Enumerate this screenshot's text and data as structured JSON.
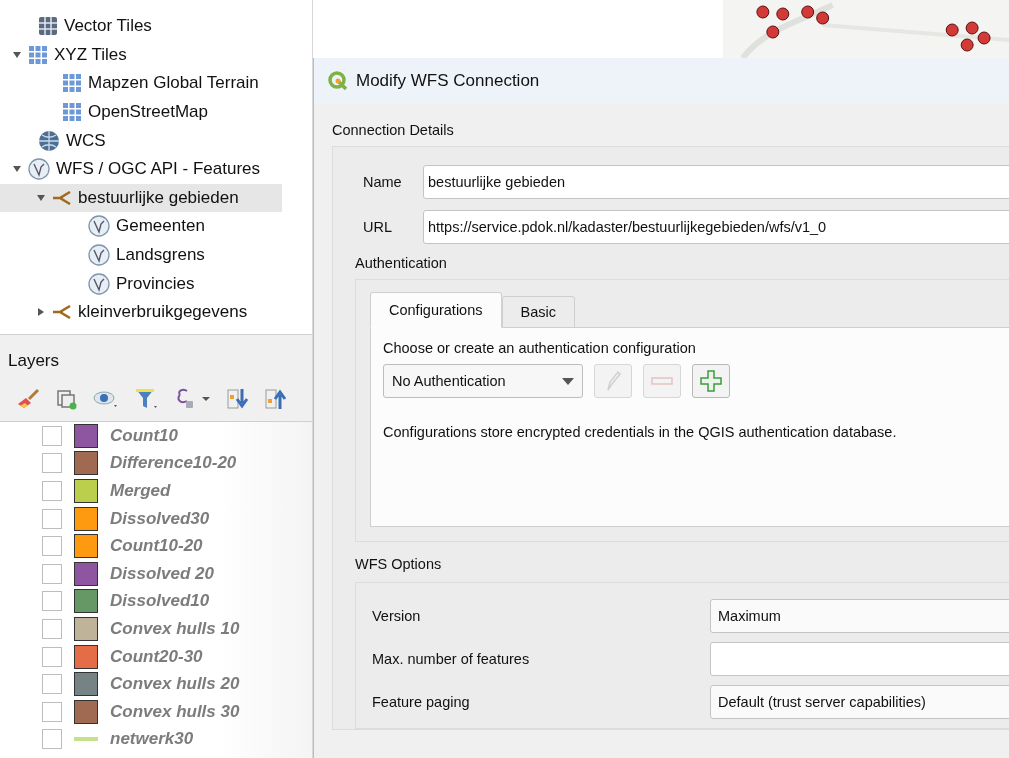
{
  "browser_tree": [
    {
      "label": "Vector Tiles",
      "kind": "vector_tiles",
      "selected": false
    },
    {
      "label": "XYZ Tiles",
      "kind": "xyz",
      "selected": false,
      "expanded": true,
      "children": [
        {
          "label": "Mapzen Global Terrain",
          "kind": "xyz",
          "selected": false
        },
        {
          "label": "OpenStreetMap",
          "kind": "xyz",
          "selected": false
        }
      ]
    },
    {
      "label": "WCS",
      "kind": "wcs",
      "selected": false
    },
    {
      "label": "WFS / OGC API - Features",
      "kind": "wfs",
      "selected": false,
      "expanded": true,
      "children": [
        {
          "label": "bestuurlijke gebieden",
          "kind": "connection",
          "selected": true,
          "expanded": true,
          "children": [
            {
              "label": "Gemeenten",
              "kind": "wfs",
              "selected": false
            },
            {
              "label": "Landsgrens",
              "kind": "wfs",
              "selected": false
            },
            {
              "label": "Provincies",
              "kind": "wfs",
              "selected": false
            }
          ]
        },
        {
          "label": "kleinverbruikgegevens",
          "kind": "connection",
          "selected": false,
          "expanded": false
        }
      ]
    }
  ],
  "layers_panel": {
    "title": "Layers",
    "layers": [
      {
        "name": "Count10",
        "kind": "fill",
        "color": "#8e56a0",
        "checked": false
      },
      {
        "name": "Difference10-20",
        "kind": "fill",
        "color": "#a06a52",
        "checked": false
      },
      {
        "name": "Merged",
        "kind": "fill",
        "color": "#bccf4c",
        "checked": false
      },
      {
        "name": "Dissolved30",
        "kind": "fill",
        "color": "#fd9a10",
        "checked": false
      },
      {
        "name": "Count10-20",
        "kind": "fill",
        "color": "#fd9a10",
        "checked": false
      },
      {
        "name": "Dissolved 20",
        "kind": "fill",
        "color": "#8e56a0",
        "checked": false
      },
      {
        "name": "Dissolved10",
        "kind": "fill",
        "color": "#669866",
        "checked": false
      },
      {
        "name": "Convex hulls 10",
        "kind": "fill",
        "color": "#bfb49a",
        "checked": false
      },
      {
        "name": "Count20-30",
        "kind": "fill",
        "color": "#e46d48",
        "checked": false
      },
      {
        "name": "Convex hulls 20",
        "kind": "fill",
        "color": "#758385",
        "checked": false
      },
      {
        "name": "Convex hulls 30",
        "kind": "fill",
        "color": "#a06a52",
        "checked": false
      },
      {
        "name": "netwerk30",
        "kind": "line",
        "color": "#c7e08a",
        "checked": false
      }
    ]
  },
  "dialog": {
    "title": "Modify WFS Connection",
    "connection_details": {
      "title": "Connection Details",
      "name_label": "Name",
      "name_value": "bestuurlijke gebieden",
      "url_label": "URL",
      "url_value": "https://service.pdok.nl/kadaster/bestuurlijkegebieden/wfs/v1_0"
    },
    "authentication": {
      "title": "Authentication",
      "tabs": [
        {
          "label": "Configurations",
          "selected": true
        },
        {
          "label": "Basic",
          "selected": false
        }
      ],
      "prompt": "Choose or create an authentication configuration",
      "config_select": "No Authentication",
      "buttons": [
        {
          "kind": "edit",
          "disabled": true
        },
        {
          "kind": "remove",
          "disabled": true
        },
        {
          "kind": "add",
          "disabled": false
        }
      ],
      "note": "Configurations store encrypted credentials in the QGIS authentication database."
    },
    "wfs_options": {
      "title": "WFS Options",
      "rows": [
        {
          "label": "Version",
          "kind": "select",
          "value": "Maximum"
        },
        {
          "label": "Max. number of features",
          "kind": "input",
          "value": ""
        },
        {
          "label": "Feature paging",
          "kind": "select",
          "value": "Default (trust server capabilities)"
        }
      ]
    }
  }
}
